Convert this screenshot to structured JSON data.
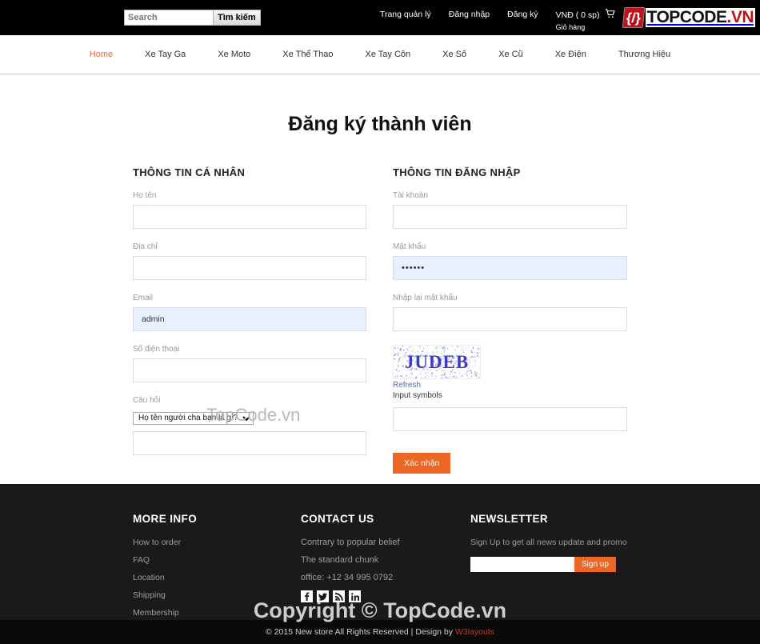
{
  "header": {
    "search": {
      "placeholder": "Search",
      "value": "",
      "button_label": "Tìm kiếm"
    },
    "links": [
      {
        "label": "Trang quản lý"
      },
      {
        "label": "Đăng nhập"
      },
      {
        "label": "Đăng ký"
      }
    ],
    "cart": {
      "currency_line": "VNĐ ( 0 sp)",
      "label": "Giỏ hàng",
      "icon": "cart-icon"
    },
    "logo": {
      "mark": "{/}",
      "name": "TOPCODE",
      "tld": ".VN"
    }
  },
  "nav": {
    "items": [
      {
        "label": "Home",
        "active": true
      },
      {
        "label": "Xe Tay Ga",
        "active": false
      },
      {
        "label": "Xe Moto",
        "active": false
      },
      {
        "label": "Xe Thể Thao",
        "active": false
      },
      {
        "label": "Xe Tay Côn",
        "active": false
      },
      {
        "label": "Xe Số",
        "active": false
      },
      {
        "label": "Xe Cũ",
        "active": false
      },
      {
        "label": "Xe Điện",
        "active": false
      },
      {
        "label": "Thương Hiệu",
        "active": false
      }
    ]
  },
  "main": {
    "title": "Đăng ký thành viên",
    "watermark": "TopCode.vn",
    "left": {
      "section_title": "THÔNG TIN CÁ NHÂN",
      "fields": {
        "fullname_label": "Họ tên",
        "fullname_value": "",
        "address_label": "Địa chỉ",
        "address_value": "",
        "email_label": "Email",
        "email_value": "admin",
        "phone_label": "Số điện thoại",
        "phone_value": "",
        "question_label": "Câu hỏi",
        "question_selected": "Họ tên người cha bạn là gì?",
        "question_options": [
          "Họ tên người cha bạn là gì?"
        ],
        "answer_value": ""
      }
    },
    "right": {
      "section_title": "THÔNG TIN ĐĂNG NHẬP",
      "fields": {
        "account_label": "Tài khoản",
        "account_value": "",
        "password_label": "Mật khẩu",
        "password_value": "••••••",
        "repassword_label": "Nhập lại mật khẩu",
        "repassword_value": ""
      },
      "captcha": {
        "text": "JUDEB",
        "refresh_label": "Refresh",
        "input_label": "Input symbols",
        "input_value": "",
        "color": "#3b3bc4"
      },
      "submit_label": "Xác nhận"
    }
  },
  "footer": {
    "more_info": {
      "title": "MORE INFO",
      "links": [
        {
          "label": "How to order"
        },
        {
          "label": "FAQ"
        },
        {
          "label": "Location"
        },
        {
          "label": "Shipping"
        },
        {
          "label": "Membership"
        }
      ]
    },
    "contact": {
      "title": "CONTACT US",
      "lines": [
        "Contrary to popular belief",
        "The standard chunk",
        "office: +12 34 995 0792"
      ],
      "socials": [
        {
          "name": "facebook-icon",
          "glyph": "f"
        },
        {
          "name": "twitter-icon",
          "glyph": "🐦"
        },
        {
          "name": "rss-icon",
          "glyph": "🖧"
        },
        {
          "name": "linkedin-icon",
          "glyph": "in"
        }
      ]
    },
    "newsletter": {
      "title": "NEWSLETTER",
      "text": "Sign Up to get all news update and promo",
      "input_value": "",
      "button_label": "Sign up"
    },
    "copyright_prefix": "© 2015 New store All Rights Reserved | Design by ",
    "copyright_link": "W3layouts",
    "watermark": "Copyright © TopCode.vn"
  },
  "colors": {
    "accent": "#ec6625",
    "nav_active": "#e8653a",
    "footer_bg": "#1a1a1a",
    "brand_red": "#c1121c"
  }
}
